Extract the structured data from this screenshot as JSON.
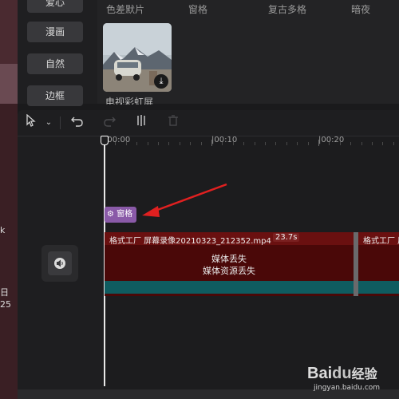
{
  "desktop": {
    "char1": "k",
    "char2": "日",
    "char3": "25"
  },
  "categories": [
    "爱心",
    "漫画",
    "自然",
    "边框"
  ],
  "filters": [
    "色差默片",
    "窗格",
    "复古多格",
    "暗夜"
  ],
  "thumbnail": {
    "caption": "电视彩虹屏",
    "download_icon": "download-icon"
  },
  "toolbar": {
    "select_icon": "cursor-icon",
    "dropdown_icon": "chevron-down-icon",
    "undo_icon": "undo-icon",
    "redo_icon": "redo-icon",
    "split_icon": "split-icon",
    "delete_icon": "trash-icon"
  },
  "ruler": [
    "|00:00",
    "|00:10",
    "|00:20"
  ],
  "effect_clip": {
    "label": "窗格",
    "icon": "effect-icon"
  },
  "clips": [
    {
      "name": "格式工厂 屏幕录像20210323_212352.mp4",
      "duration": "23.7s",
      "error1": "媒体丢失",
      "error2": "媒体资源丢失"
    },
    {
      "name": "格式工厂 屏幕"
    }
  ],
  "audio": {
    "icon": "speaker-icon"
  },
  "watermark": {
    "brand": "Bai",
    "paw": "du",
    "suffix": "经验",
    "url": "jingyan.baidu.com"
  },
  "colors": {
    "clip_bg": "#4a0808",
    "clip_head": "#6a1010",
    "teal": "#0f5c60",
    "effect": "#8a5aa8",
    "arrow": "#e02020"
  }
}
